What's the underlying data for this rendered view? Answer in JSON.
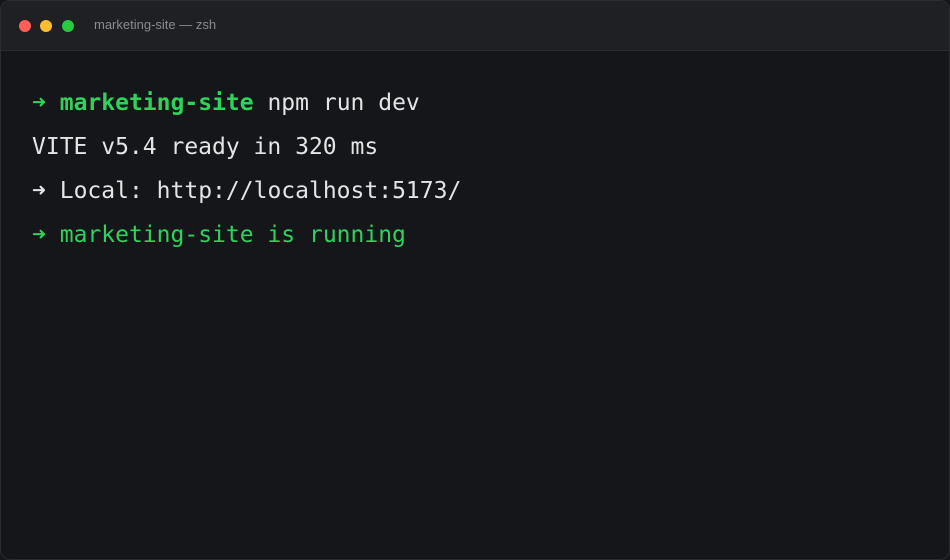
{
  "window": {
    "title": "marketing-site — zsh"
  },
  "traffic_lights": {
    "close_color": "#ff5f57",
    "minimize_color": "#febc2e",
    "maximize_color": "#28c840"
  },
  "terminal": {
    "lines": [
      {
        "arrow": "➜",
        "dir": "marketing-site",
        "command": "npm run dev"
      },
      {
        "text": "VITE v5.4 ready in 320 ms"
      },
      {
        "arrow": "➜",
        "label": "Local:",
        "url": "http://localhost:5173/"
      },
      {
        "arrow": "➜",
        "text": "marketing-site is running"
      }
    ],
    "accent_color": "#2fd35a",
    "text_color": "#e4e4e6"
  }
}
